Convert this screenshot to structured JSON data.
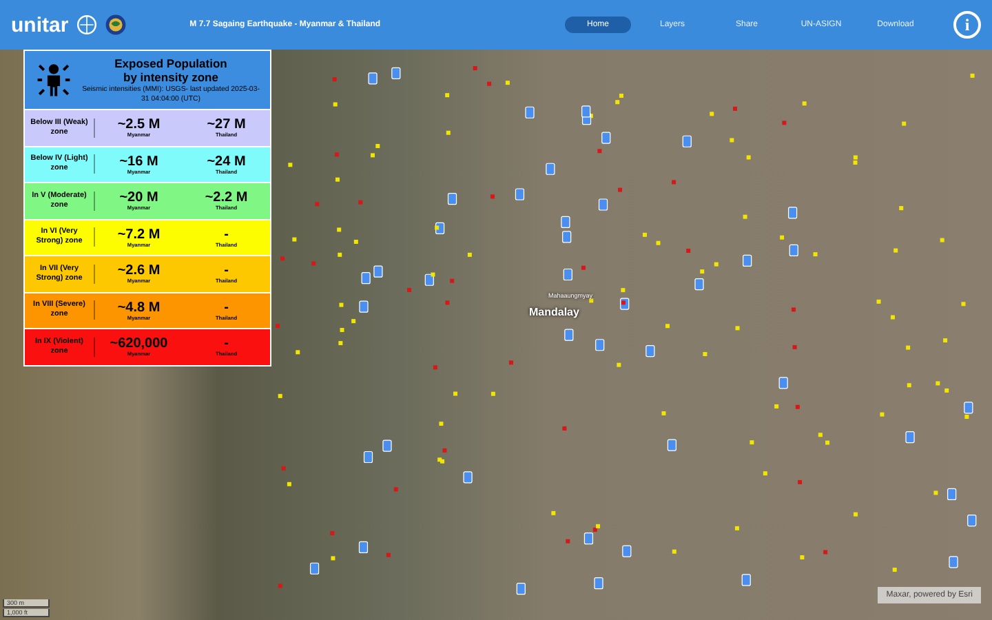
{
  "header": {
    "brand": "unitar",
    "title": "M 7.7 Sagaing Earthquake - Myanmar & Thailand",
    "nav": [
      {
        "label": "Home",
        "selected": true
      },
      {
        "label": "Layers",
        "selected": false
      },
      {
        "label": "Share",
        "selected": false
      },
      {
        "label": "UN-ASIGN",
        "selected": false
      },
      {
        "label": "Download",
        "selected": false
      }
    ],
    "info": "i"
  },
  "panel": {
    "title": "Exposed Population by intensity zone",
    "subtitle": "Seismic intensities (MMI): USGS- last updated 2025-03-31 04:04:00 (UTC)",
    "rows": [
      {
        "zone": "Below III (Weak) zone",
        "myanmar": "~2.5 M",
        "myanmar_label": "Myanmar",
        "thailand": "~27 M",
        "thailand_label": "Thailand",
        "color": "#c9c9fb"
      },
      {
        "zone": "Below IV (Light) zone",
        "myanmar": "~16 M",
        "myanmar_label": "Myanmar",
        "thailand": "~24 M",
        "thailand_label": "Thailand",
        "color": "#80fbfb"
      },
      {
        "zone": "In V (Moderate) zone",
        "myanmar": "~20 M",
        "myanmar_label": "Myanmar",
        "thailand": "~2.2 M",
        "thailand_label": "Thailand",
        "color": "#80f784"
      },
      {
        "zone": "In VI (Very Strong) zone",
        "myanmar": "~7.2 M",
        "myanmar_label": "Myanmar",
        "thailand": "-",
        "thailand_label": "Thailand",
        "color": "#fdfd00"
      },
      {
        "zone": "In VII (Very Strong) zone",
        "myanmar": "~2.6 M",
        "myanmar_label": "Myanmar",
        "thailand": "-",
        "thailand_label": "Thailand",
        "color": "#fdc800"
      },
      {
        "zone": "In VIII (Severe) zone",
        "myanmar": "~4.8 M",
        "myanmar_label": "Myanmar",
        "thailand": "-",
        "thailand_label": "Thailand",
        "color": "#fc9500"
      },
      {
        "zone": "In IX (Violent) zone",
        "myanmar": "~620,000",
        "myanmar_label": "Myanmar",
        "thailand": "-",
        "thailand_label": "Thailand",
        "color": "#fb1010"
      }
    ]
  },
  "map": {
    "labels": [
      {
        "text": "Mahaaungmyay",
        "kind": "district"
      },
      {
        "text": "Mandalay",
        "kind": "city"
      }
    ],
    "scale": [
      "300 m",
      "1,000 ft"
    ],
    "attribution": "Maxar, powered by Esri"
  }
}
